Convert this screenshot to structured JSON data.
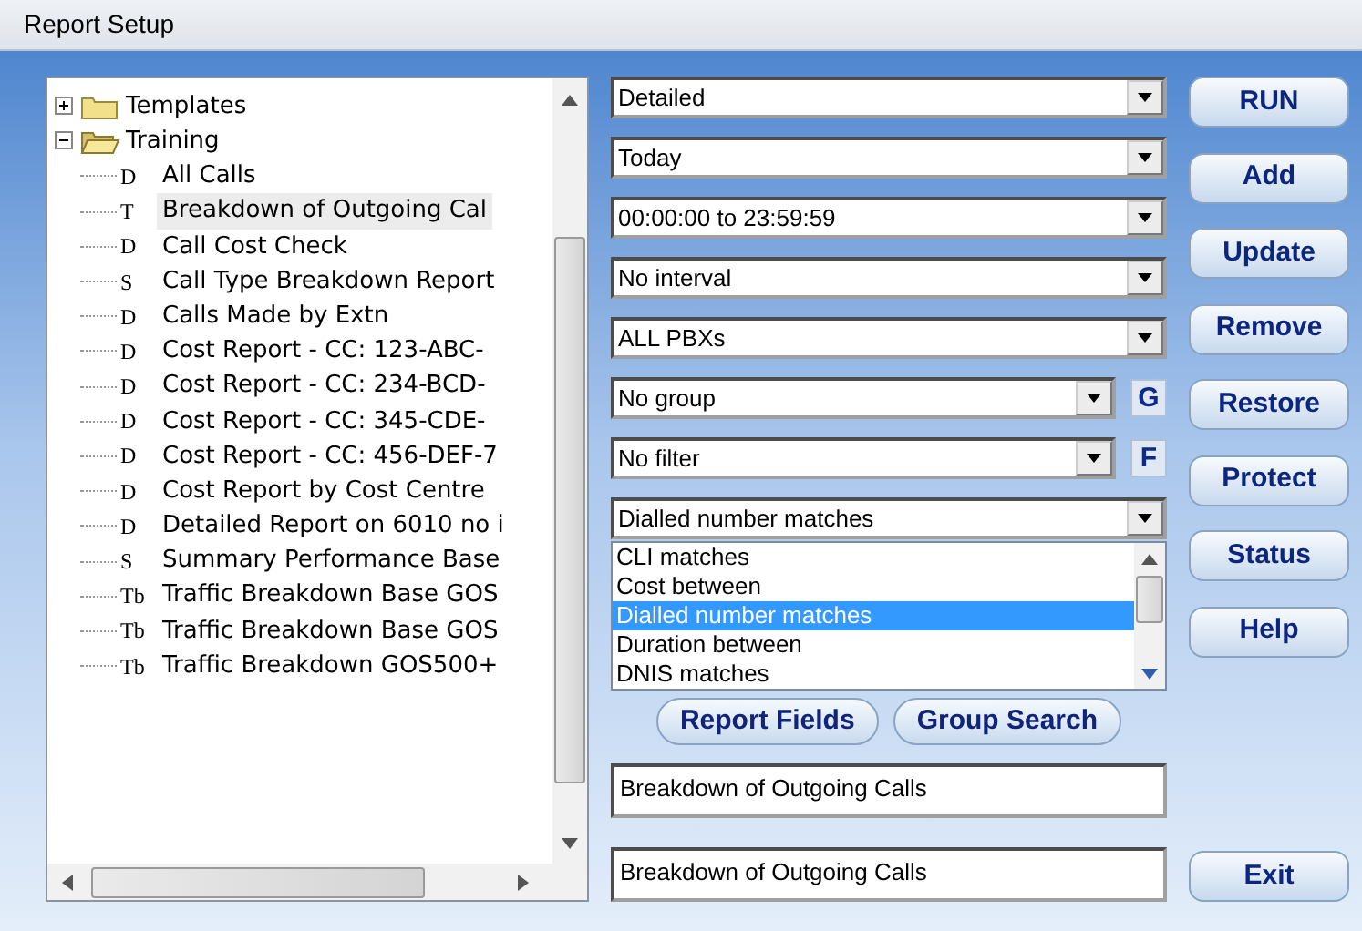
{
  "window": {
    "title": "Report Setup"
  },
  "tree": [
    {
      "label": "Templates",
      "expanded": false
    },
    {
      "label": "Training",
      "expanded": true,
      "children": [
        {
          "badge": "D",
          "label": "All Calls",
          "selected": false
        },
        {
          "badge": "T",
          "label": "Breakdown of Outgoing Cal",
          "selected": true
        },
        {
          "badge": "D",
          "label": "Call Cost Check",
          "selected": false
        },
        {
          "badge": "S",
          "label": "Call Type Breakdown Report",
          "selected": false
        },
        {
          "badge": "D",
          "label": "Calls Made by Extn",
          "selected": false
        },
        {
          "badge": "D",
          "label": "Cost Report - CC: 123-ABC-",
          "selected": false
        },
        {
          "badge": "D",
          "label": "Cost Report - CC: 234-BCD-",
          "selected": false
        },
        {
          "badge": "D",
          "label": "Cost Report - CC: 345-CDE-",
          "selected": false
        },
        {
          "badge": "D",
          "label": "Cost Report - CC: 456-DEF-7",
          "selected": false
        },
        {
          "badge": "D",
          "label": "Cost Report by Cost Centre",
          "selected": false
        },
        {
          "badge": "D",
          "label": "Detailed Report on 6010 no i",
          "selected": false
        },
        {
          "badge": "S",
          "label": "Summary Performance Base",
          "selected": false
        },
        {
          "badge": "Tb",
          "label": "Traffic Breakdown Base GOS",
          "selected": false
        },
        {
          "badge": "Tb",
          "label": "Traffic Breakdown Base GOS",
          "selected": false
        },
        {
          "badge": "Tb",
          "label": "Traffic Breakdown GOS500+",
          "selected": false
        }
      ]
    }
  ],
  "dropdowns": [
    {
      "value": "Detailed"
    },
    {
      "value": "Today"
    },
    {
      "value": "00:00:00 to 23:59:59"
    },
    {
      "value": "No interval"
    },
    {
      "value": "ALL PBXs"
    },
    {
      "value": "No group",
      "side_button": "G"
    },
    {
      "value": "No filter",
      "side_button": "F"
    },
    {
      "value": "Dialled number matches"
    }
  ],
  "filter_list": [
    {
      "label": "CLI matches",
      "selected": false
    },
    {
      "label": "Cost between",
      "selected": false
    },
    {
      "label": "Dialled number matches",
      "selected": true
    },
    {
      "label": "Duration between",
      "selected": false
    },
    {
      "label": "DNIS matches",
      "selected": false
    }
  ],
  "mid_buttons": [
    "Report Fields",
    "Group Search"
  ],
  "text_fields": [
    {
      "value": "Breakdown of Outgoing Calls"
    },
    {
      "value": "Breakdown of Outgoing Calls"
    }
  ],
  "side_buttons": [
    "RUN",
    "Add",
    "Update",
    "Remove",
    "Restore",
    "Protect",
    "Status",
    "Help"
  ],
  "exit_button": "Exit"
}
